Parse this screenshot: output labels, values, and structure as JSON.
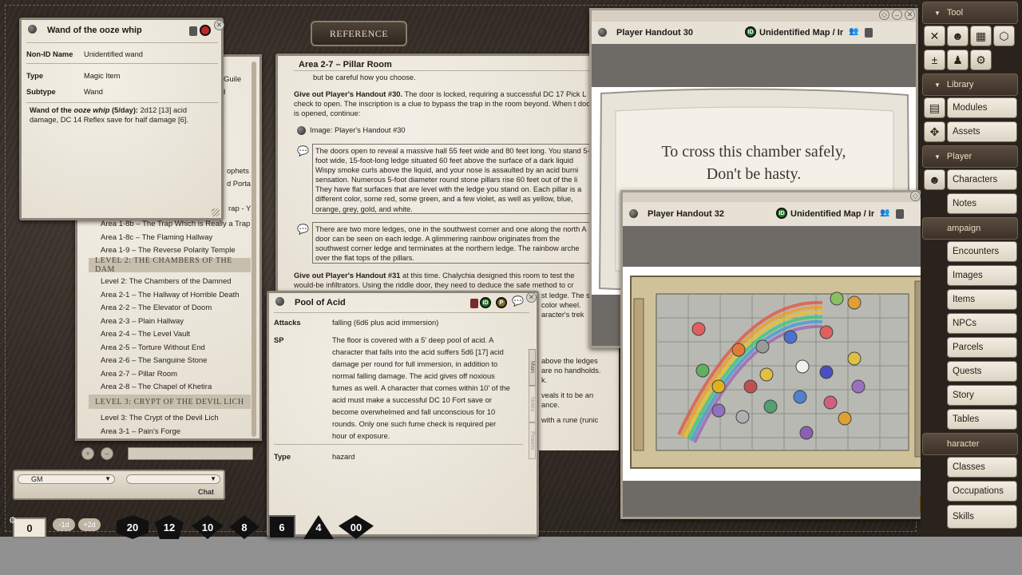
{
  "reference_button": "REFERENCE",
  "wand": {
    "title": "Wand of the ooze whip",
    "rows": [
      {
        "label": "Non-ID Name",
        "value": "Unidentified wand"
      },
      {
        "label": "Type",
        "value": "Magic Item"
      },
      {
        "label": "Subtype",
        "value": "Wand"
      }
    ],
    "desc_bold": "Wand of the ",
    "desc_italic": "ooze whip",
    "desc_bold2": " (5/day):",
    "desc_rest": " 2d12 [13] acid damage, DC 14 Reflex save for half damage [6]."
  },
  "index": {
    "partial": [
      "Guile",
      "d",
      "ophets",
      "d Porta",
      "rap - Y"
    ],
    "items_a": [
      "Area 1-8b – The Trap Which is Really a Trap",
      "Area 1-8c – The Flaming Hallway",
      "Area 1-9 – The Reverse Polarity Temple"
    ],
    "level2_head": "LEVEL 2: THE CHAMBERS OF THE DAM",
    "items_b": [
      "Level 2: The Chambers of the Damned",
      "Area 2-1 – The Hallway of Horrible Death",
      "Area 2-2 – The Elevator of Doom",
      "Area 2-3 – Plain Hallway",
      "Area 2-4 – The Level Vault",
      "Area 2-5 – Torture Without End",
      "Area 2-6 – The Sanguine Stone",
      "Area 2-7 – Pillar Room",
      "Area 2-8 – The Chapel of Khetira"
    ],
    "level3_head": "LEVEL 3: CRYPT OF THE DEVIL LICH",
    "items_c": [
      "Level 3: The Crypt of the Devil Lich",
      "Area 3-1 – Pain's Forge"
    ]
  },
  "story": {
    "title": "Area 2-7 – Pillar Room",
    "line0": "but be careful how you choose.",
    "p1_bold": "Give out Player's Handout #30.",
    "p1_rest": " The door is locked, requiring a successful DC 17 Pick L check to open. The inscription is a clue to bypass the trap in the room beyond. When t door is opened, continue:",
    "image_link": "Image: Player's Handout #30",
    "box1": "The doors open to reveal a massive hall 55 feet wide and 80 feet long. You stand 5-foot wide, 15-foot-long ledge situated 60 feet above the surface of a dark liquid Wispy smoke curls above the liquid, and your nose is assaulted by an acid burni sensation. Numerous 5-foot diameter round stone pillars rise 60 feet out of the li They have flat surfaces that are level with the ledge you stand on. Each pillar is a different color, some red, some green, and a few violet, as well as yellow, blue, orange, grey, gold, and white.",
    "box2": "There are two more ledges, one in the southwest corner and one along the north A door can be seen on each ledge. A glimmering rainbow originates from the southwest corner ledge and terminates at the northern ledge. The rainbow arche over the flat tops of the pillars.",
    "p2_bold": "Give out Player's Handout #31",
    "p2_rest": " at this time. Chalychia designed this room to test the would-be infiltrators. Using the riddle door, they need to deduce the safe method to cr",
    "frag": [
      "st ledge. The s",
      "color wheel.",
      "aracter's trek",
      "above the ledges",
      "are no handholds.",
      "k.",
      "veals it to be an",
      "ance.",
      "with a rune (runic"
    ]
  },
  "acid": {
    "title": "Pool of Acid",
    "attacks_label": "Attacks",
    "attacks_value": "falling (6d6 plus acid immersion)",
    "sp_label": "SP",
    "sp_value": "The floor is covered with a 5' deep pool of acid. A character that falls into the acid suffers 5d6 [17] acid damage per round for full immersion, in addition to normal falling damage. The acid gives off noxious fumes as well. A character that comes within 10' of the acid must make a successful DC 10 Fort save or become overwhelmed and fall unconscious for 10 rounds. Only one such fume check is required per hour of exposure.",
    "type_label": "Type",
    "type_value": "hazard",
    "tabs": [
      "Main",
      "Notes",
      "Powers"
    ]
  },
  "h30": {
    "title": "Player Handout 30",
    "map": "Unidentified Map / Ir",
    "line1": "To cross this chamber safely,",
    "line2": "Don't be hasty."
  },
  "h32": {
    "title": "Player Handout 32",
    "map": "Unidentified Map / Ir"
  },
  "chat": {
    "speaker": "GM",
    "chat_label": "Chat",
    "mod": "0",
    "mod_minus": "-1d",
    "mod_plus": "+2d"
  },
  "dice": [
    "20",
    "12",
    "10",
    "8",
    "6",
    "4",
    "00"
  ],
  "sidebar": {
    "tool": "Tool",
    "library": "Library",
    "player": "Player",
    "campaign": "ampaign",
    "character": "haracter",
    "items": [
      "Modules",
      "Assets",
      "Characters",
      "Notes",
      "Encounters",
      "Images",
      "Items",
      "NPCs",
      "Parcels",
      "Quests",
      "Story",
      "Tables",
      "Classes",
      "Occupations",
      "Skills"
    ]
  }
}
